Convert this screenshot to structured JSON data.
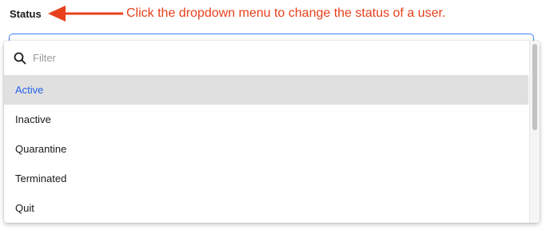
{
  "field": {
    "label": "Status"
  },
  "annotation": {
    "text": "Click the dropdown menu to change the status of a user.",
    "color": "#e8401c"
  },
  "dropdown": {
    "filter_placeholder": "Filter",
    "filter_value": "",
    "selected_index": 0,
    "options": [
      {
        "label": "Active"
      },
      {
        "label": "Inactive"
      },
      {
        "label": "Quarantine"
      },
      {
        "label": "Terminated"
      },
      {
        "label": "Quit"
      }
    ]
  },
  "icons": {
    "filter": "search-icon",
    "annotation": "arrow-left-icon"
  },
  "colors": {
    "selected_text": "#2563eb",
    "selected_bg": "#e0e0e0",
    "focus_border": "#3b82f6"
  }
}
